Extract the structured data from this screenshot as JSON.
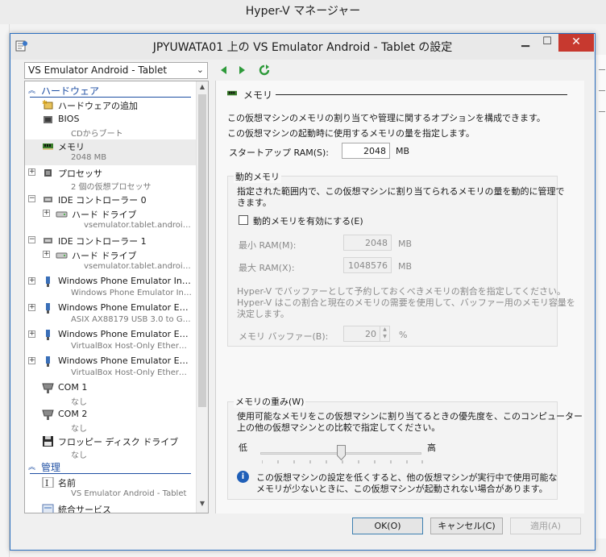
{
  "background_window": {
    "title": "Hyper-V マネージャー"
  },
  "dialog": {
    "title": "JPYUWATA01 上の VS Emulator Android - Tablet の設定"
  },
  "vm_selector": {
    "value": "VS Emulator Android - Tablet"
  },
  "tree": {
    "hardware_header": "ハードウェア",
    "management_header": "管理",
    "items": [
      {
        "name": "ハードウェアの追加",
        "sub": ""
      },
      {
        "name": "BIOS",
        "sub": "CDからブート"
      },
      {
        "name": "メモリ",
        "sub": "2048 MB"
      },
      {
        "name": "プロセッサ",
        "sub": "2 個の仮想プロセッサ"
      },
      {
        "name": "IDE コントローラー 0",
        "sub": ""
      },
      {
        "name": "ハード ドライブ",
        "sub": "vsemulator.tablet.android...."
      },
      {
        "name": "IDE コントローラー 1",
        "sub": ""
      },
      {
        "name": "ハード ドライブ",
        "sub": "vsemulator.tablet.android...."
      },
      {
        "name": "Windows Phone Emulator Inter...",
        "sub": "Windows Phone Emulator Inter..."
      },
      {
        "name": "Windows Phone Emulator Exter...",
        "sub": "ASIX AX88179 USB 3.0 to Giga..."
      },
      {
        "name": "Windows Phone Emulator Exter...",
        "sub": "VirtualBox Host-Only Ethernet ..."
      },
      {
        "name": "Windows Phone Emulator Exter...",
        "sub": "VirtualBox Host-Only Ethernet ..."
      },
      {
        "name": "COM 1",
        "sub": "なし"
      },
      {
        "name": "COM 2",
        "sub": "なし"
      },
      {
        "name": "フロッピー ディスク ドライブ",
        "sub": "なし"
      },
      {
        "name": "名前",
        "sub": "VS Emulator Android - Tablet"
      },
      {
        "name": "統合サービス",
        "sub": ""
      }
    ]
  },
  "memory": {
    "header": "メモリ",
    "desc1": "この仮想マシンのメモリの割り当てや管理に関するオプションを構成できます。",
    "desc2": "この仮想マシンの起動時に使用するメモリの量を指定します。",
    "startup_label": "スタートアップ RAM(S):",
    "startup_value": "2048",
    "unit_mb": "MB",
    "dynamic": {
      "group_title": "動的メモリ",
      "desc_l1": "指定された範囲内で、この仮想マシンに割り当てられるメモリの量を動的に管理で",
      "desc_l2": "きます。",
      "enable_label": "動的メモリを有効にする(E)",
      "min_label": "最小 RAM(M):",
      "min_value": "2048",
      "max_label": "最大 RAM(X):",
      "max_value": "1048576",
      "buffer_desc_l1": "Hyper-V でバッファーとして予約しておくべきメモリの割合を指定してください。",
      "buffer_desc_l2": "Hyper-V はこの割合と現在のメモリの需要を使用して、バッファー用のメモリ容量を",
      "buffer_desc_l3": "決定します。",
      "buffer_label": "メモリ バッファー(B):",
      "buffer_value": "20",
      "percent": "%"
    },
    "weight": {
      "group_title": "メモリの重み(W)",
      "desc_l1": "使用可能なメモリをこの仮想マシンに割り当てるときの優先度を、このコンピューター",
      "desc_l2": "上の他の仮想マシンとの比較で指定してください。",
      "low": "低",
      "high": "高",
      "level": 0.5,
      "info_l1": "この仮想マシンの設定を低くすると、他の仮想マシンが実行中で使用可能な",
      "info_l2": "メモリが少ないときに、この仮想マシンが起動されない場合があります。"
    }
  },
  "buttons": {
    "ok": "OK(O)",
    "cancel": "キャンセル(C)",
    "apply": "適用(A)"
  },
  "colors": {
    "accent": "#1f4fa3",
    "close": "#c7392f",
    "nav_green": "#2e9a3a"
  }
}
